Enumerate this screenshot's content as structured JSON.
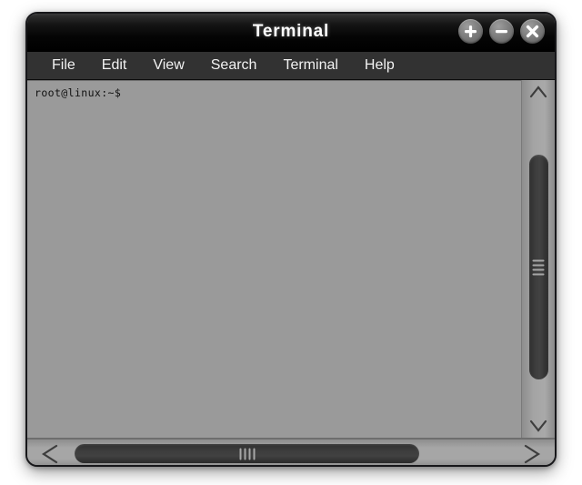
{
  "window": {
    "title": "Terminal",
    "controls": [
      {
        "name": "maximize-button",
        "icon": "plus-icon",
        "label": "+"
      },
      {
        "name": "minimize-button",
        "icon": "minus-icon",
        "label": "−"
      },
      {
        "name": "close-button",
        "icon": "close-icon",
        "label": "×"
      }
    ]
  },
  "menubar": {
    "items": [
      {
        "label": "File"
      },
      {
        "label": "Edit"
      },
      {
        "label": "View"
      },
      {
        "label": "Search"
      },
      {
        "label": "Terminal"
      },
      {
        "label": "Help"
      }
    ]
  },
  "terminal": {
    "prompt": "root@linux:~$",
    "lines": [
      "root@linux:~$"
    ],
    "background_color": "#9a9a9a",
    "text_color": "#111111"
  },
  "scrollbars": {
    "vertical": {
      "up_arrow_icon": "chevron-up-icon",
      "down_arrow_icon": "chevron-down-icon",
      "grip_lines": 4
    },
    "horizontal": {
      "left_arrow_icon": "chevron-left-icon",
      "right_arrow_icon": "chevron-right-icon",
      "grip_lines": 4
    }
  },
  "colors": {
    "titlebar": "#000000",
    "menubar": "#323232",
    "window_border": "#17171a",
    "scrollbar_thumb": "#3a3a3a",
    "scrollbar_track": "#a6a6a6",
    "page_background": "#ffffff"
  }
}
